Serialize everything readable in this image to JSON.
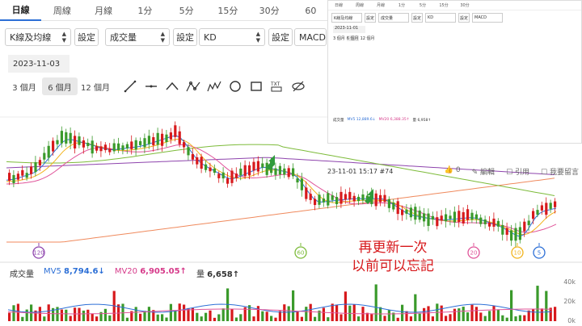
{
  "tabs": [
    "日線",
    "周線",
    "月線",
    "1分",
    "5分",
    "15分",
    "30分",
    "60"
  ],
  "active_tab": 0,
  "selectors": {
    "kline": "K線及均線",
    "volume": "成交量",
    "indicator": "KD",
    "extra": "MACD",
    "settings_label": "設定"
  },
  "date": "2023-11-03",
  "ranges": [
    "3 個月",
    "6 個月",
    "12 個月"
  ],
  "active_range": 1,
  "tool_icons": [
    "line-tool-icon",
    "hline-tool-icon",
    "angle-tool-icon",
    "abc-pattern-icon",
    "wave-pattern-icon",
    "circle-tool-icon",
    "rect-tool-icon",
    "text-tool-icon",
    "hide-icon"
  ],
  "tool_text": "TXT",
  "volume_bar": {
    "label": "成交量",
    "mv5_label": "MV5",
    "mv5_value": "8,794.6↓",
    "mv20_label": "MV20",
    "mv20_value": "6,905.05↑",
    "vol_label": "量",
    "vol_value": "6,658↑"
  },
  "vol_axis": [
    "40k",
    "20k",
    "0k"
  ],
  "badges": [
    "120",
    "60",
    "20",
    "10",
    "5"
  ],
  "inset": {
    "date": "2023-11-01",
    "ranges": [
      "3 個月",
      "6 個月",
      "12 個月"
    ],
    "vol_text": [
      "成交量",
      "MV5 12,889.6↓",
      "MV20 6,388.35↑",
      "量 6,958↑"
    ]
  },
  "post_bar": {
    "timestamp": "23-11-01 15:17 #74",
    "count": "0",
    "edit": "編輯",
    "quote": "引用",
    "reply": "我要留言"
  },
  "note_lines": [
    "再更新一次",
    "以前可以忘記"
  ],
  "colors": {
    "up": "#d7191c",
    "down": "#3a9a2b",
    "accent": "#2c6fd6",
    "arrow": "#2e9b3c"
  }
}
